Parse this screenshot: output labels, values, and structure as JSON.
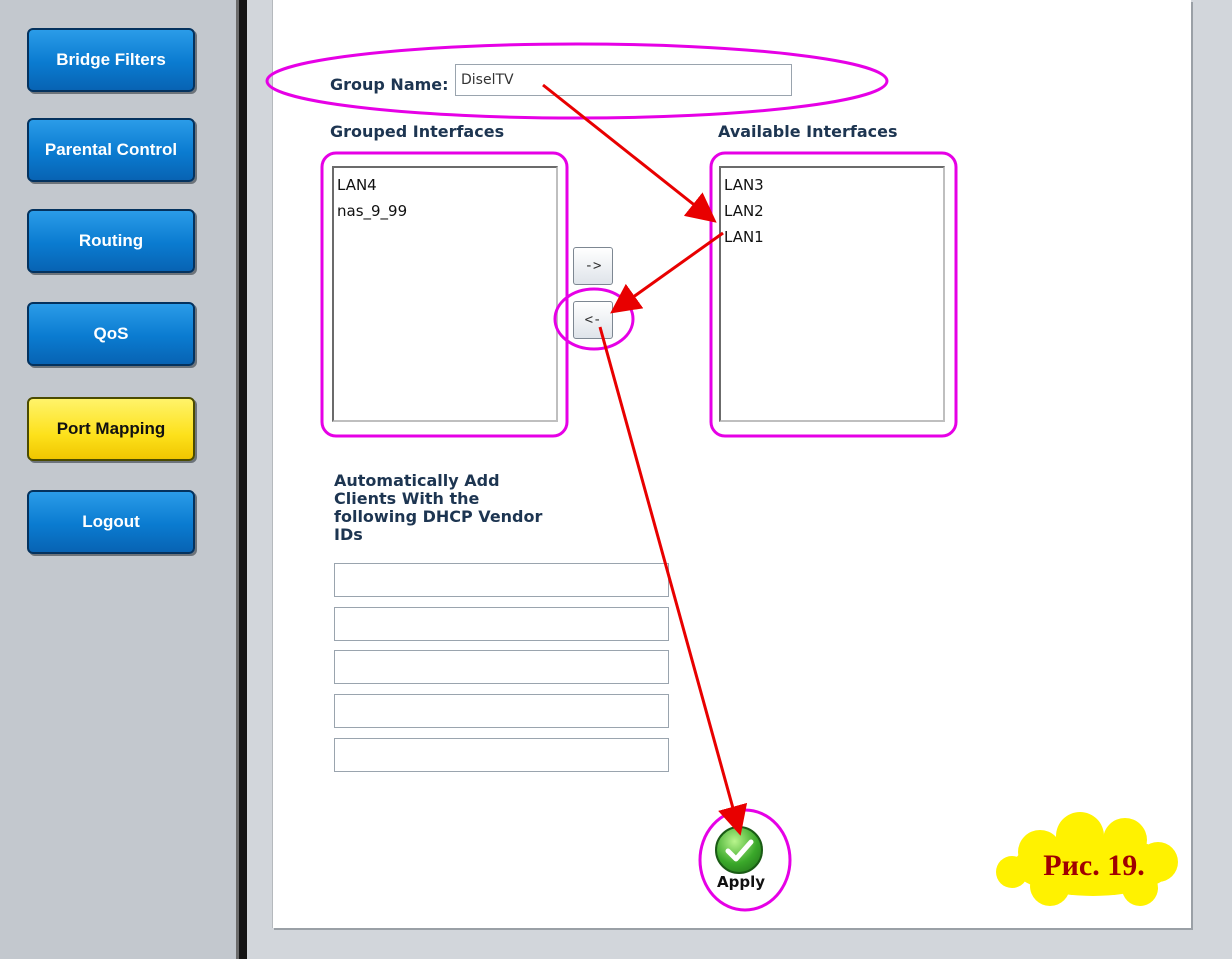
{
  "sidebar": {
    "items": [
      {
        "label": "Bridge Filters",
        "active": false
      },
      {
        "label": "Parental Control",
        "active": false
      },
      {
        "label": "Routing",
        "active": false
      },
      {
        "label": "QoS",
        "active": false
      },
      {
        "label": "Port Mapping",
        "active": true
      },
      {
        "label": "Logout",
        "active": false
      }
    ]
  },
  "form": {
    "group_name_label": "Group Name:",
    "group_name_value": "DiselTV",
    "grouped_title": "Grouped Interfaces",
    "available_title": "Available Interfaces",
    "grouped_items": [
      "LAN4",
      "nas_9_99"
    ],
    "available_items": [
      "LAN3",
      "LAN2",
      "LAN1"
    ],
    "move_right_label": "->",
    "move_left_label": "<-",
    "vendor_ids_label": "Automatically Add Clients With the following DHCP Vendor IDs",
    "apply_label": "Apply"
  },
  "annotation": {
    "caption": "Рис. 19.",
    "highlight_color": "#e600e6",
    "arrow_color": "#e80000",
    "cloud_color": "#fff200"
  }
}
